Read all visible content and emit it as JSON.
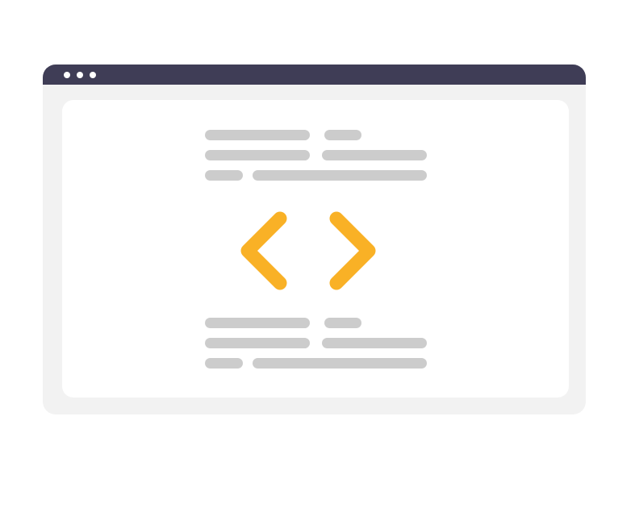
{
  "window": {
    "titlebar_color": "#3f3d56",
    "frame_color": "#f2f2f2",
    "panel_color": "#ffffff",
    "controls": [
      "window-dot",
      "window-dot",
      "window-dot"
    ]
  },
  "placeholder_lines": {
    "color": "#cccccc",
    "top_group_lines": 6,
    "bottom_group_lines": 6
  },
  "icon": {
    "name": "code-brackets-icon",
    "color": "#f9b126"
  }
}
